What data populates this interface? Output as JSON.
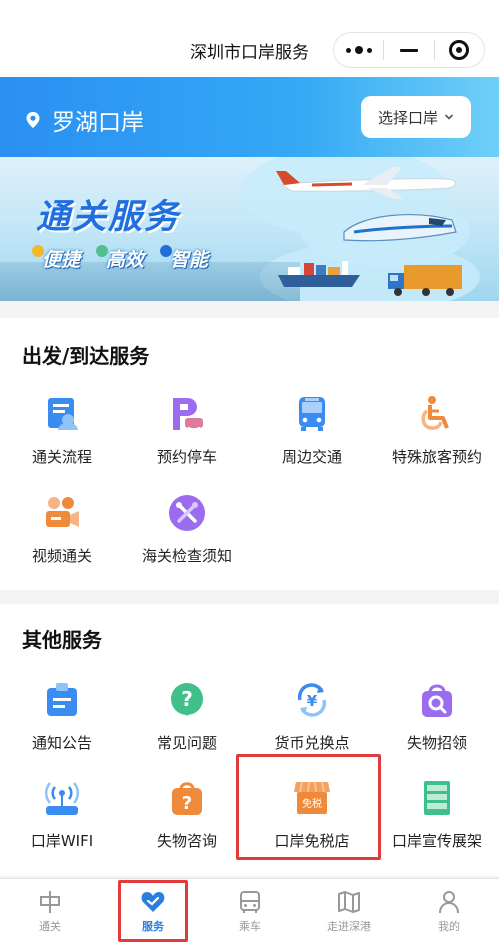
{
  "topbar": {
    "title": "深圳市口岸服务"
  },
  "port": {
    "name": "罗湖口岸",
    "select_label": "选择口岸"
  },
  "banner": {
    "title": "通关服务",
    "tags": [
      "便捷",
      "高效",
      "智能"
    ]
  },
  "departure": {
    "title": "出发/到达服务",
    "items": [
      {
        "label": "通关流程",
        "icon": "clearance-process-icon",
        "color": "#3b8cf0"
      },
      {
        "label": "预约停车",
        "icon": "parking-icon",
        "color": "#9b6cf0"
      },
      {
        "label": "周边交通",
        "icon": "bus-icon",
        "color": "#3b8cf0"
      },
      {
        "label": "特殊旅客预约",
        "icon": "wheelchair-icon",
        "color": "#f08a3b"
      },
      {
        "label": "视频通关",
        "icon": "video-call-icon",
        "color": "#f08a3b"
      },
      {
        "label": "海关检查须知",
        "icon": "tools-icon",
        "color": "#9b6cf0"
      }
    ]
  },
  "other": {
    "title": "其他服务",
    "items": [
      {
        "label": "通知公告",
        "icon": "notice-icon",
        "color": "#3b8cf0"
      },
      {
        "label": "常见问题",
        "icon": "question-icon",
        "color": "#3fbf8a"
      },
      {
        "label": "货币兑换点",
        "icon": "currency-exchange-icon",
        "color": "#3b8cf0"
      },
      {
        "label": "失物招领",
        "icon": "lost-found-bag-icon",
        "color": "#9b6cf0"
      },
      {
        "label": "口岸WIFI",
        "icon": "wifi-icon",
        "color": "#3b8cf0"
      },
      {
        "label": "失物咨询",
        "icon": "lost-inquiry-icon",
        "color": "#f08a3b"
      },
      {
        "label": "口岸免税店",
        "icon": "duty-free-shop-icon",
        "color": "#f08a3b",
        "badge": "免税"
      },
      {
        "label": "口岸宣传展架",
        "icon": "display-rack-icon",
        "color": "#3fbf8a"
      }
    ]
  },
  "tabbar": {
    "items": [
      {
        "label": "通关",
        "icon": "clearance-tab-icon",
        "active": false
      },
      {
        "label": "服务",
        "icon": "service-heart-icon",
        "active": true
      },
      {
        "label": "乘车",
        "icon": "car-tab-icon",
        "active": false
      },
      {
        "label": "走进深港",
        "icon": "map-tab-icon",
        "active": false
      },
      {
        "label": "我的",
        "icon": "profile-tab-icon",
        "active": false
      }
    ]
  },
  "colors": {
    "accent": "#2a7de1",
    "highlight": "#e23b3b"
  }
}
